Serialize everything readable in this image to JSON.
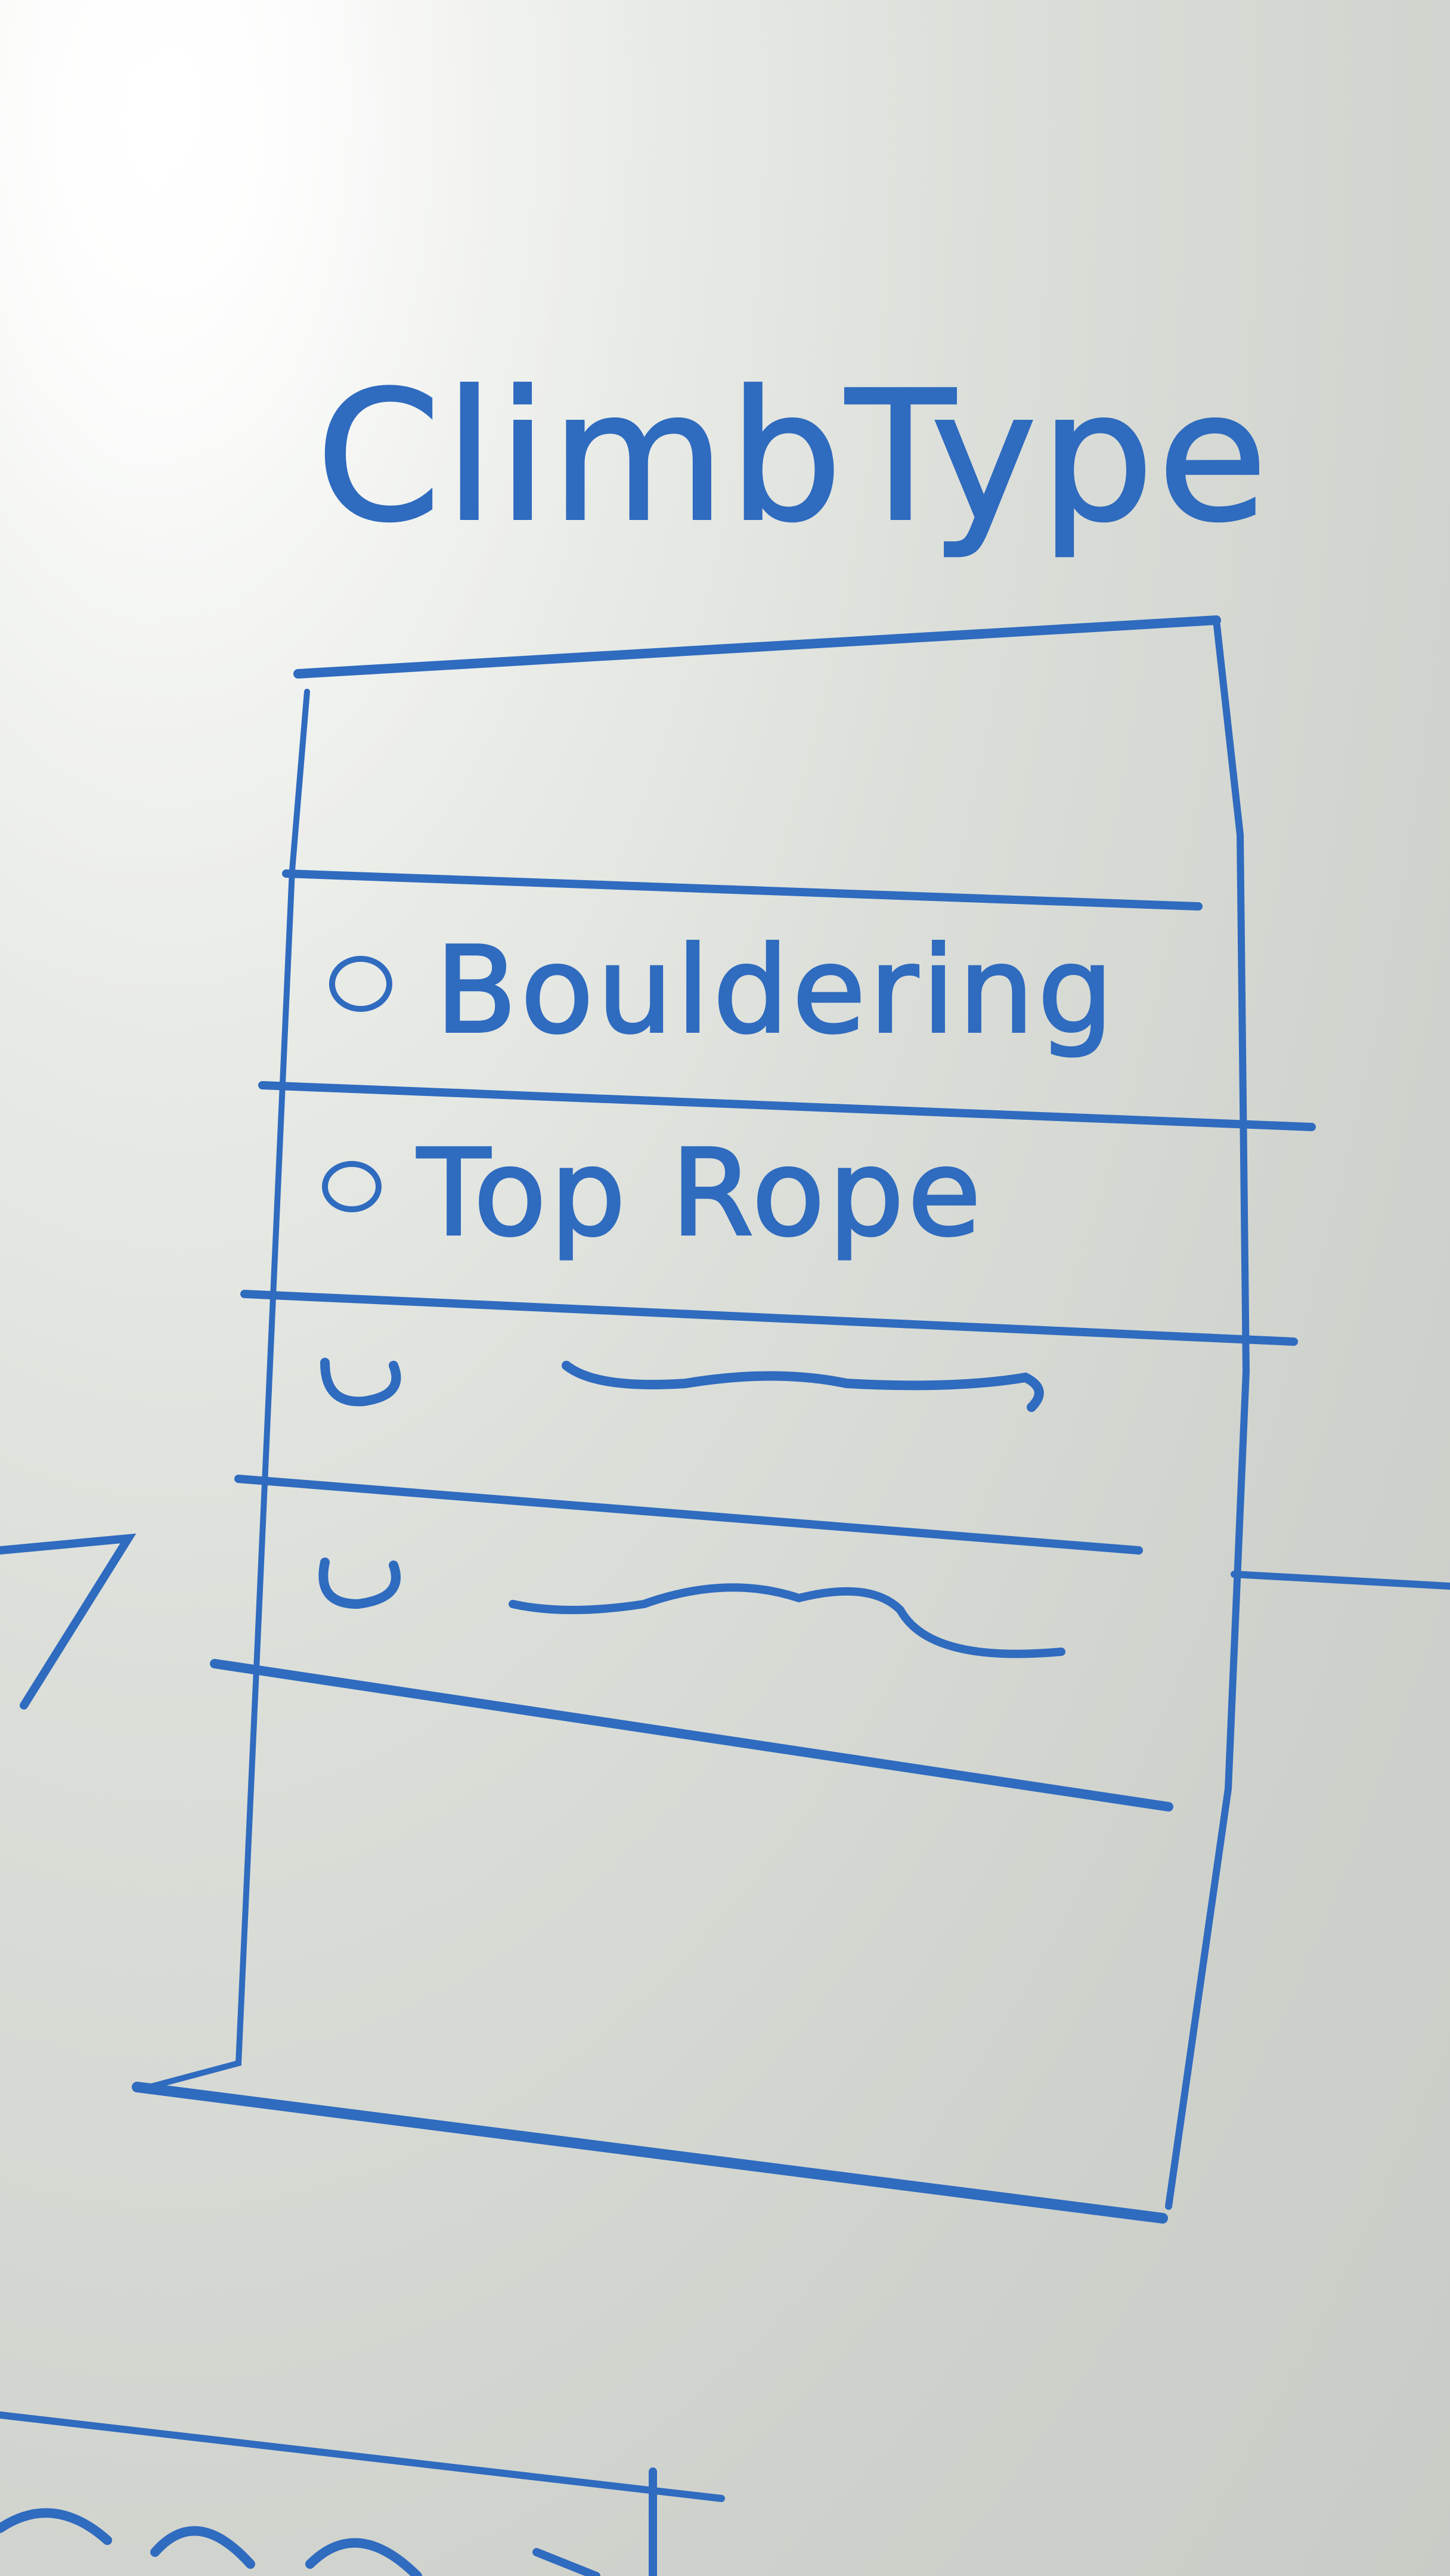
{
  "wireframe": {
    "title": "ClimbType",
    "options": [
      {
        "label": "Bouldering",
        "selected": false
      },
      {
        "label": "Top Rope",
        "selected": false
      }
    ],
    "placeholder_options": 2
  },
  "colors": {
    "ink": "#2f6bbf",
    "board": "#dcdfd9"
  }
}
